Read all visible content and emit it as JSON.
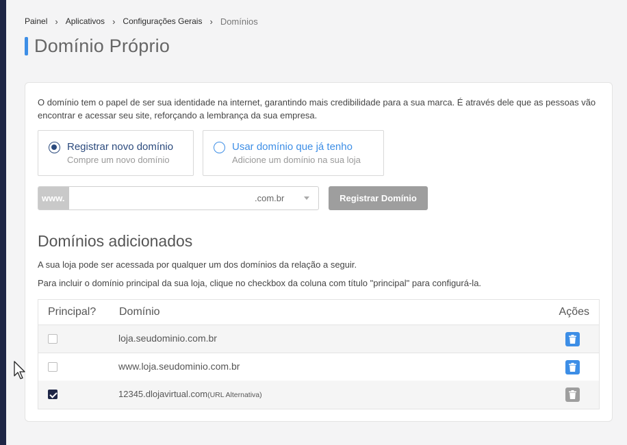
{
  "breadcrumb": {
    "items": [
      "Painel",
      "Aplicativos",
      "Configurações Gerais"
    ],
    "current": "Domínios"
  },
  "page": {
    "title": "Domínio Próprio"
  },
  "intro_text": "O domínio tem o papel de ser sua identidade na internet, garantindo mais credibilidade para a sua marca. É através dele que as pessoas vão encontrar e acessar seu site, reforçando a lembrança da sua empresa.",
  "options": [
    {
      "title": "Registrar novo domínio",
      "subtitle": "Compre um novo domínio",
      "selected": true
    },
    {
      "title": "Usar domínio que já tenho",
      "subtitle": "Adicione um domínio na sua loja",
      "selected": false
    }
  ],
  "domain_form": {
    "prefix": "www.",
    "value": "",
    "tld": ".com.br",
    "button_label": "Registrar Domínio"
  },
  "added": {
    "title": "Domínios adicionados",
    "help1": "A sua loja pode ser acessada por qualquer um dos domínios da relação a seguir.",
    "help2": "Para incluir o domínio principal da sua loja, clique no checkbox da coluna com título \"principal\" para configurá-la.",
    "columns": [
      "Principal?",
      "Domínio",
      "Ações"
    ],
    "rows": [
      {
        "principal": false,
        "domain": "loja.seudominio.com.br",
        "note": "",
        "delete_enabled": true
      },
      {
        "principal": false,
        "domain": "www.loja.seudominio.com.br",
        "note": "",
        "delete_enabled": true
      },
      {
        "principal": true,
        "domain": "12345.dlojavirtual.com",
        "note": "(URL Alternativa)",
        "delete_enabled": false
      }
    ]
  },
  "colors": {
    "accent": "#3d8ee6",
    "navy": "#2b4a7d",
    "sidebar": "#1e2646",
    "disabled": "#9e9e9e"
  }
}
